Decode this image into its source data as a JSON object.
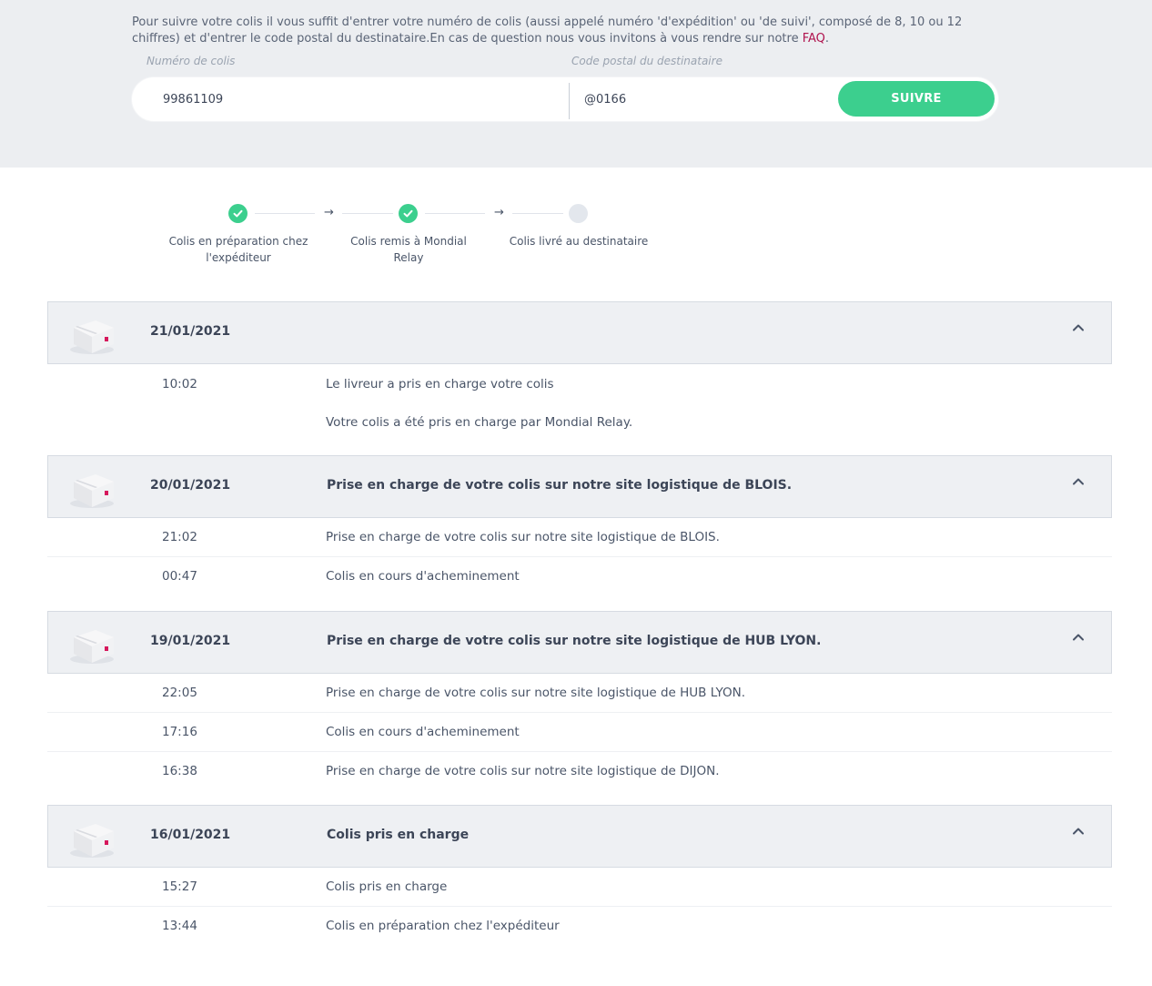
{
  "intro": {
    "text": "Pour suivre votre colis il vous suffit d'entrer votre numéro de colis (aussi appelé numéro 'd'expédition' ou 'de suivi', composé de 8, 10 ou 12 chiffres) et d'entrer le code postal du destinataire.En cas de question nous vous invitons à vous rendre sur notre ",
    "faq_label": "FAQ",
    "period": "."
  },
  "search": {
    "num_label": "Numéro de colis",
    "num_value": "99861109",
    "cp_label": "Code postal du destinataire",
    "cp_value": "@0166",
    "submit_label": "SUIVRE"
  },
  "steps": [
    {
      "label": "Colis en préparation chez l'expéditeur",
      "done": true
    },
    {
      "label": "Colis remis à Mondial Relay",
      "done": true
    },
    {
      "label": "Colis livré au destinataire",
      "done": false
    }
  ],
  "colors": {
    "accent_green": "#3ccf8e",
    "faq_link": "#b0134e",
    "box_mark": "#d6185c"
  },
  "days": [
    {
      "date": "21/01/2021",
      "title": "",
      "events": [
        {
          "time": "10:02",
          "text": "Le livreur a pris en charge votre colis"
        },
        {
          "time": "",
          "text": "Votre colis a été pris en charge par Mondial Relay."
        }
      ]
    },
    {
      "date": "20/01/2021",
      "title": "Prise en charge de votre colis sur notre site logistique de BLOIS.",
      "events": [
        {
          "time": "21:02",
          "text": "Prise en charge de votre colis sur notre site logistique de BLOIS."
        },
        {
          "time": "00:47",
          "text": "Colis en cours d'acheminement"
        }
      ]
    },
    {
      "date": "19/01/2021",
      "title": "Prise en charge de votre colis sur notre site logistique de HUB LYON.",
      "events": [
        {
          "time": "22:05",
          "text": "Prise en charge de votre colis sur notre site logistique de HUB LYON."
        },
        {
          "time": "17:16",
          "text": "Colis en cours d'acheminement"
        },
        {
          "time": "16:38",
          "text": "Prise en charge de votre colis sur notre site logistique de DIJON."
        }
      ]
    },
    {
      "date": "16/01/2021",
      "title": "Colis pris en charge",
      "events": [
        {
          "time": "15:27",
          "text": "Colis pris en charge"
        },
        {
          "time": "13:44",
          "text": "Colis en préparation chez l'expéditeur"
        }
      ]
    }
  ]
}
